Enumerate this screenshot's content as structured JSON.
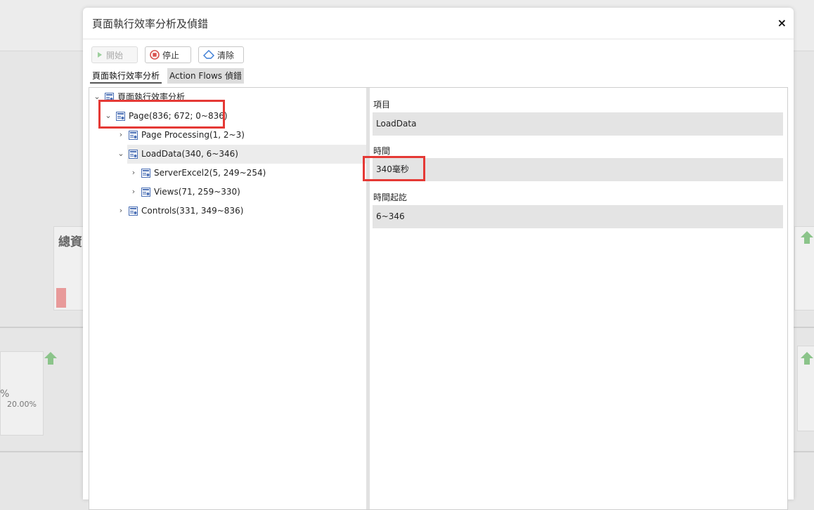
{
  "background": {
    "card_title": "總資",
    "percent_partial": "%",
    "percent_value": "20.00%"
  },
  "modal": {
    "title": "頁面執行效率分析及偵錯",
    "close_symbol": "×"
  },
  "toolbar": {
    "start_label": "開始",
    "stop_label": "停止",
    "clear_label": "清除"
  },
  "tabs": [
    {
      "label": "頁面執行效率分析",
      "active": true
    },
    {
      "label": "Action Flows 偵錯",
      "active": false
    }
  ],
  "tree": {
    "root": "頁面執行效率分析",
    "page": "Page(836; 672; 0~836)",
    "page_processing": "Page Processing(1, 2~3)",
    "loaddata": "LoadData(340, 6~346)",
    "server_excel": "ServerExcel2(5, 249~254)",
    "views": "Views(71, 259~330)",
    "controls": "Controls(331, 349~836)",
    "selected": "LoadData(340, 6~346)"
  },
  "details": {
    "item_label": "項目",
    "item_value": "LoadData",
    "time_label": "時間",
    "time_value": "340毫秒",
    "range_label": "時間起訖",
    "range_value": "6~346"
  },
  "colors": {
    "highlight_box": "#e53935",
    "arrow_green": "#8bc48a",
    "icon_blue": "#4a6fb5"
  }
}
